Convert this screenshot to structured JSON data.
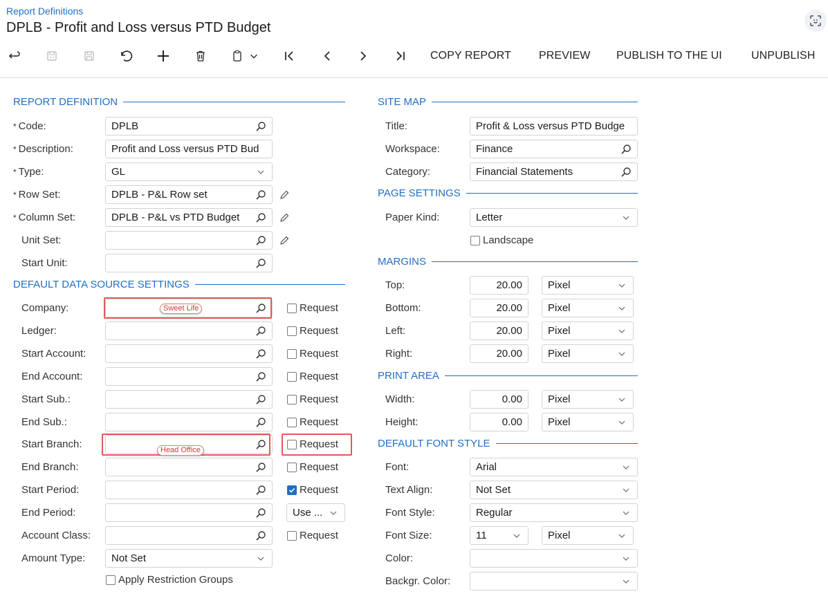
{
  "header": {
    "breadcrumb": "Report Definitions",
    "title": "DPLB - Profit and Loss versus PTD Budget"
  },
  "toolbar": {
    "copy_report": "COPY REPORT",
    "preview": "PREVIEW",
    "publish": "PUBLISH TO THE UI",
    "unpublish": "UNPUBLISH"
  },
  "report_definition": {
    "heading": "REPORT DEFINITION",
    "code_label": "Code:",
    "code": "DPLB",
    "description_label": "Description:",
    "description": "Profit and Loss versus PTD Bud",
    "type_label": "Type:",
    "type": "GL",
    "row_set_label": "Row Set:",
    "row_set": "DPLB - P&L Row set",
    "column_set_label": "Column Set:",
    "column_set": "DPLB - P&L vs PTD Budget",
    "unit_set_label": "Unit Set:",
    "unit_set": "",
    "start_unit_label": "Start Unit:",
    "start_unit": ""
  },
  "data_source": {
    "heading": "DEFAULT DATA SOURCE SETTINGS",
    "request_label": "Request",
    "company_label": "Company:",
    "company_annotation": "Sweet Life",
    "ledger_label": "Ledger:",
    "start_account_label": "Start Account:",
    "end_account_label": "End Account:",
    "start_sub_label": "Start Sub.:",
    "end_sub_label": "End Sub.:",
    "start_branch_label": "Start Branch:",
    "start_branch_annotation": "Head Office",
    "end_branch_label": "End Branch:",
    "start_period_label": "Start Period:",
    "end_period_label": "End Period:",
    "end_period_option": "Use ...",
    "account_class_label": "Account Class:",
    "amount_type_label": "Amount Type:",
    "amount_type": "Not Set",
    "apply_restriction_label": "Apply Restriction Groups",
    "start_period_request_checked": true
  },
  "site_map": {
    "heading": "SITE MAP",
    "title_label": "Title:",
    "title": "Profit & Loss versus PTD Budge",
    "workspace_label": "Workspace:",
    "workspace": "Finance",
    "category_label": "Category:",
    "category": "Financial Statements"
  },
  "page_settings": {
    "heading": "PAGE SETTINGS",
    "paper_kind_label": "Paper Kind:",
    "paper_kind": "Letter",
    "landscape_label": "Landscape"
  },
  "margins": {
    "heading": "MARGINS",
    "top_label": "Top:",
    "top": "20.00",
    "top_unit": "Pixel",
    "bottom_label": "Bottom:",
    "bottom": "20.00",
    "bottom_unit": "Pixel",
    "left_label": "Left:",
    "left": "20.00",
    "left_unit": "Pixel",
    "right_label": "Right:",
    "right": "20.00",
    "right_unit": "Pixel"
  },
  "print_area": {
    "heading": "PRINT AREA",
    "width_label": "Width:",
    "width": "0.00",
    "width_unit": "Pixel",
    "height_label": "Height:",
    "height": "0.00",
    "height_unit": "Pixel"
  },
  "font_style": {
    "heading": "DEFAULT FONT STYLE",
    "font_label": "Font:",
    "font": "Arial",
    "text_align_label": "Text Align:",
    "text_align": "Not Set",
    "font_style_label": "Font Style:",
    "font_style": "Regular",
    "font_size_label": "Font Size:",
    "font_size": "11",
    "font_size_unit": "Pixel",
    "color_label": "Color:",
    "color": "",
    "backgr_color_label": "Backgr. Color:",
    "backgr_color": ""
  },
  "colors": {
    "accent": "#1f6fc2",
    "highlight": "#e05a5a"
  }
}
